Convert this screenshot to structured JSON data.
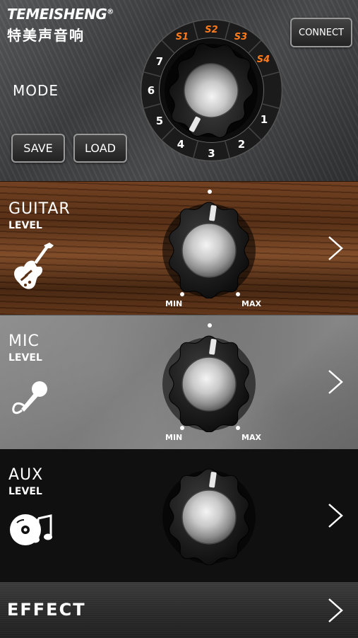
{
  "header": {
    "brand_en": "TEMEISHENG",
    "brand_reg": "®",
    "brand_cn": "特美声音响",
    "mode_label": "MODE",
    "save_label": "SAVE",
    "load_label": "LOAD",
    "connect_label": "CONNECT",
    "mode_dial": {
      "positions": [
        "1",
        "2",
        "3",
        "4",
        "5",
        "6",
        "7",
        "S1",
        "S2",
        "S3",
        "S4"
      ],
      "number_color": "#ffffff",
      "preset_color": "#ff7a1a"
    }
  },
  "guitar": {
    "title": "GUITAR",
    "subtitle": "LEVEL",
    "min_label": "MIN",
    "max_label": "MAX",
    "icon": "electric-guitar-icon"
  },
  "mic": {
    "title": "MIC",
    "subtitle": "LEVEL",
    "min_label": "MIN",
    "max_label": "MAX",
    "icon": "microphone-icon"
  },
  "aux": {
    "title": "AUX",
    "subtitle": "LEVEL",
    "icon": "music-disc-icon"
  },
  "effect": {
    "title": "EFFECT"
  },
  "colors": {
    "accent_orange": "#ff7a1a",
    "text": "#ffffff"
  }
}
